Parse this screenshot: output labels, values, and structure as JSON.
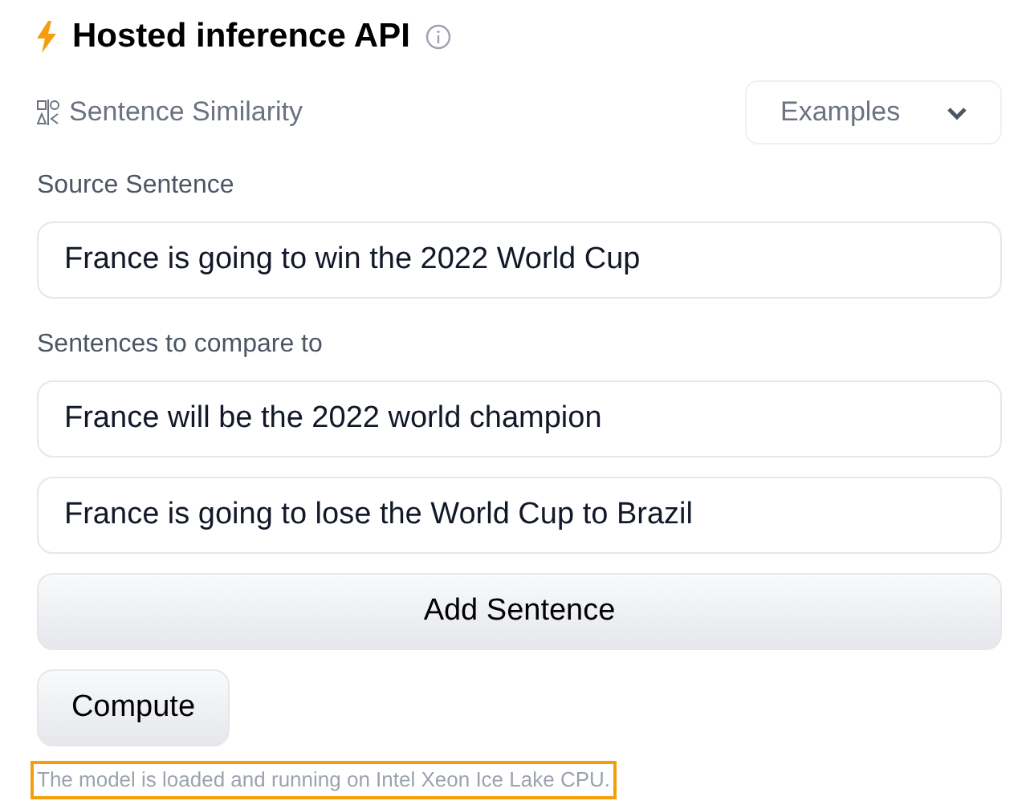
{
  "header": {
    "title": "Hosted inference API"
  },
  "task": {
    "label": "Sentence Similarity"
  },
  "examples": {
    "label": "Examples"
  },
  "source": {
    "label": "Source Sentence",
    "value": "France is going to win the 2022 World Cup"
  },
  "compare": {
    "label": "Sentences to compare to",
    "values": [
      "France will be the 2022 world champion",
      "France is going to lose the World Cup to Brazil"
    ]
  },
  "add_button": "Add Sentence",
  "compute_button": "Compute",
  "status": "The model is loaded and running on Intel Xeon Ice Lake CPU."
}
